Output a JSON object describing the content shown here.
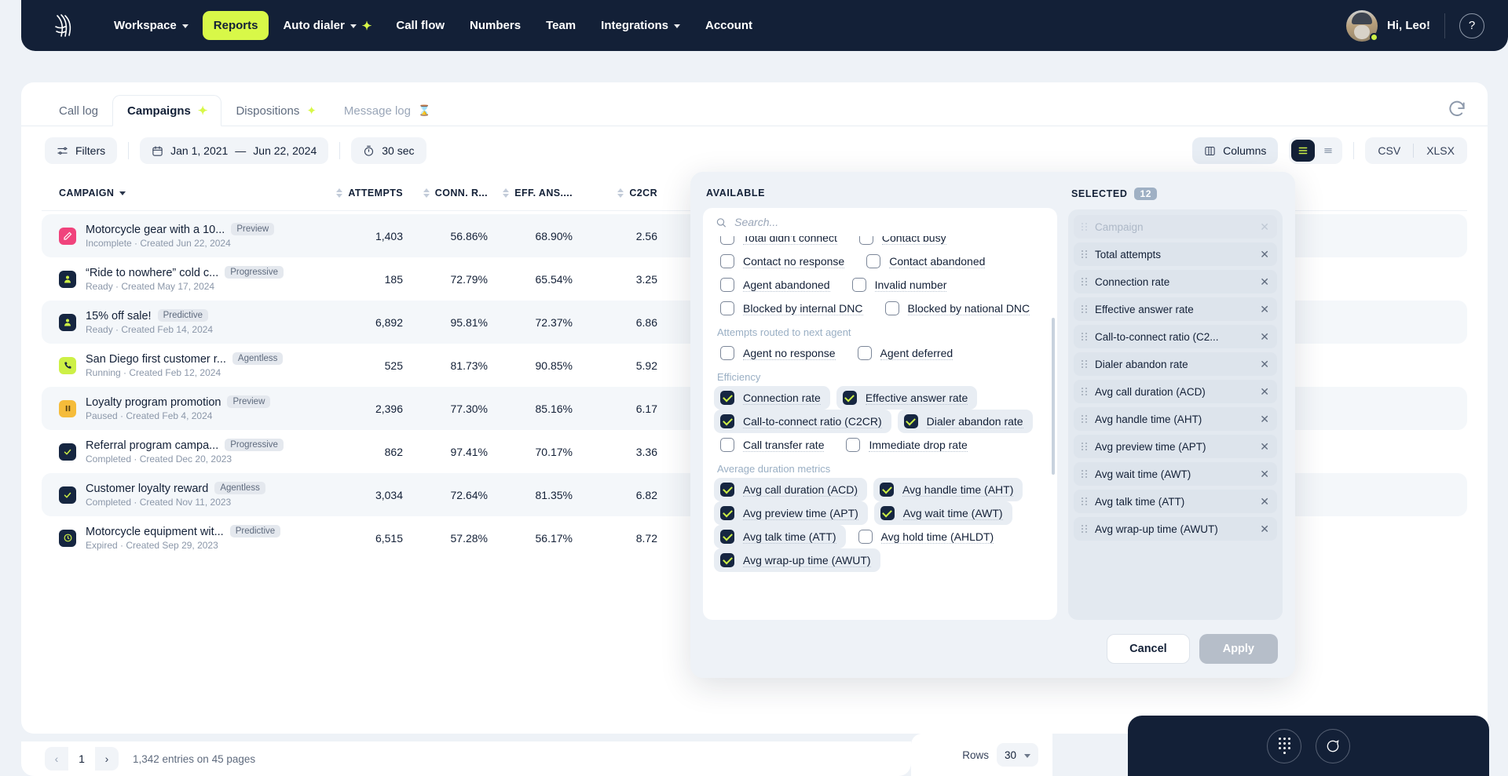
{
  "nav": {
    "logo_icon": "wavy-lines-logo",
    "items": [
      {
        "label": "Workspace",
        "caret": true,
        "sparkle": false,
        "active": false
      },
      {
        "label": "Reports",
        "caret": false,
        "sparkle": false,
        "active": true
      },
      {
        "label": "Auto dialer",
        "caret": true,
        "sparkle": true,
        "active": false
      },
      {
        "label": "Call flow",
        "caret": false,
        "sparkle": false,
        "active": false
      },
      {
        "label": "Numbers",
        "caret": false,
        "sparkle": false,
        "active": false
      },
      {
        "label": "Team",
        "caret": false,
        "sparkle": false,
        "active": false
      },
      {
        "label": "Integrations",
        "caret": true,
        "sparkle": false,
        "active": false
      },
      {
        "label": "Account",
        "caret": false,
        "sparkle": false,
        "active": false
      }
    ],
    "greeting": "Hi, Leo!",
    "help_icon": "question-mark-icon",
    "accent_color": "#d8f848",
    "bar_color": "#132037"
  },
  "tabs": [
    {
      "label": "Call log",
      "active": false,
      "sparkle": false,
      "muted": false,
      "icon": ""
    },
    {
      "label": "Campaigns",
      "active": true,
      "sparkle": true,
      "muted": false,
      "icon": ""
    },
    {
      "label": "Dispositions",
      "active": false,
      "sparkle": true,
      "muted": false,
      "icon": ""
    },
    {
      "label": "Message log",
      "active": false,
      "sparkle": false,
      "muted": true,
      "icon": "hourglass-icon"
    }
  ],
  "toolbar": {
    "filters_label": "Filters",
    "date_start": "Jan 1, 2021",
    "date_dash": "—",
    "date_end": "Jun 22, 2024",
    "interval_label": "30 sec",
    "columns_label": "Columns",
    "export_csv": "CSV",
    "export_xlsx": "XLSX"
  },
  "table": {
    "headers": [
      {
        "label": "CAMPAIGN",
        "sort": "desc-caret"
      },
      {
        "label": "ATTEMPTS",
        "sort": "both"
      },
      {
        "label": "CONN. R...",
        "sort": "both"
      },
      {
        "label": "EFF. ANS....",
        "sort": "both"
      },
      {
        "label": "C2CR",
        "sort": "both"
      }
    ],
    "rows": [
      {
        "icon": "pencil-icon",
        "icon_bg": "#f0437c",
        "name": "Motorcycle gear with a 10...",
        "badge": "Preview",
        "status": "Incomplete",
        "created": "Created Jun 22, 2024",
        "attempts": "1,403",
        "conn": "56.86%",
        "eff": "68.90%",
        "c2cr": "2.56"
      },
      {
        "icon": "person-icon",
        "icon_bg": "#162641",
        "name": "“Ride to nowhere” cold c...",
        "badge": "Progressive",
        "status": "Ready",
        "created": "Created May 17, 2024",
        "attempts": "185",
        "conn": "72.79%",
        "eff": "65.54%",
        "c2cr": "3.25"
      },
      {
        "icon": "person-icon",
        "icon_bg": "#162641",
        "name": "15% off sale!",
        "badge": "Predictive",
        "status": "Ready",
        "created": "Created Feb 14, 2024",
        "attempts": "6,892",
        "conn": "95.81%",
        "eff": "72.37%",
        "c2cr": "6.86"
      },
      {
        "icon": "phone-icon",
        "icon_bg": "#cdf046",
        "name": "San Diego first customer r...",
        "badge": "Agentless",
        "status": "Running",
        "created": "Created Feb 12, 2024",
        "attempts": "525",
        "conn": "81.73%",
        "eff": "90.85%",
        "c2cr": "5.92"
      },
      {
        "icon": "pause-icon",
        "icon_bg": "#f5bc3a",
        "name": "Loyalty program promotion",
        "badge": "Preview",
        "status": "Paused",
        "created": "Created Feb 4, 2024",
        "attempts": "2,396",
        "conn": "77.30%",
        "eff": "85.16%",
        "c2cr": "6.17"
      },
      {
        "icon": "check-icon",
        "icon_bg": "#162641",
        "name": "Referral program campa...",
        "badge": "Progressive",
        "status": "Completed",
        "created": "Created Dec 20, 2023",
        "attempts": "862",
        "conn": "97.41%",
        "eff": "70.17%",
        "c2cr": "3.36"
      },
      {
        "icon": "check-icon",
        "icon_bg": "#162641",
        "name": "Customer loyalty reward",
        "badge": "Agentless",
        "status": "Completed",
        "created": "Created Nov 11, 2023",
        "attempts": "3,034",
        "conn": "72.64%",
        "eff": "81.35%",
        "c2cr": "6.82"
      },
      {
        "icon": "clock-icon",
        "icon_bg": "#162641",
        "name": "Motorcycle equipment wit...",
        "badge": "Predictive",
        "status": "Expired",
        "created": "Created Sep 29, 2023",
        "attempts": "6,515",
        "conn": "57.28%",
        "eff": "56.17%",
        "c2cr": "8.72"
      }
    ]
  },
  "pagination": {
    "prev_icon": "chevron-left-icon",
    "page": "1",
    "next_icon": "chevron-right-icon",
    "entries": "1,342 entries on 45 pages",
    "rows_label": "Rows",
    "rows_value": "30"
  },
  "widget": {
    "dialpad_icon": "dialpad-icon",
    "chat_icon": "chat-bubble-icon"
  },
  "modal": {
    "available_title": "AVAILABLE",
    "selected_title": "SELECTED",
    "selected_count": "12",
    "search_placeholder": "Search...",
    "search_value": "",
    "cancel_label": "Cancel",
    "apply_label": "Apply",
    "available_groups": [
      {
        "group": "",
        "rows": [
          [
            {
              "label": "Total didn’t connect",
              "checked": false
            },
            {
              "label": "Contact busy",
              "checked": false
            }
          ],
          [
            {
              "label": "Contact no response",
              "checked": false
            },
            {
              "label": "Contact abandoned",
              "checked": false
            }
          ],
          [
            {
              "label": "Agent abandoned",
              "checked": false
            },
            {
              "label": "Invalid number",
              "checked": false
            }
          ],
          [
            {
              "label": "Blocked by internal DNC",
              "checked": false
            },
            {
              "label": "Blocked by national DNC",
              "checked": false
            }
          ]
        ]
      },
      {
        "group": "Attempts routed to next agent",
        "rows": [
          [
            {
              "label": "Agent no response",
              "checked": false
            },
            {
              "label": "Agent deferred",
              "checked": false
            }
          ]
        ]
      },
      {
        "group": "Efficiency",
        "rows": [
          [
            {
              "label": "Connection rate",
              "checked": true
            },
            {
              "label": "Effective answer rate",
              "checked": true
            }
          ],
          [
            {
              "label": "Call-to-connect ratio (C2CR)",
              "checked": true
            },
            {
              "label": "Dialer abandon rate",
              "checked": true
            }
          ],
          [
            {
              "label": "Call transfer rate",
              "checked": false
            },
            {
              "label": "Immediate drop rate",
              "checked": false
            }
          ]
        ]
      },
      {
        "group": "Average duration metrics",
        "rows": [
          [
            {
              "label": "Avg call duration (ACD)",
              "checked": true
            },
            {
              "label": "Avg handle time (AHT)",
              "checked": true
            }
          ],
          [
            {
              "label": "Avg preview time (APT)",
              "checked": true
            },
            {
              "label": "Avg wait time (AWT)",
              "checked": true
            }
          ],
          [
            {
              "label": "Avg talk time (ATT)",
              "checked": true
            },
            {
              "label": "Avg hold time (AHLDT)",
              "checked": false
            }
          ],
          [
            {
              "label": "Avg wrap-up time (AWUT)",
              "checked": true
            }
          ]
        ]
      }
    ],
    "selected_items": [
      {
        "label": "Campaign",
        "disabled": true
      },
      {
        "label": "Total attempts",
        "disabled": false
      },
      {
        "label": "Connection rate",
        "disabled": false
      },
      {
        "label": "Effective answer rate",
        "disabled": false
      },
      {
        "label": "Call-to-connect ratio (C2...",
        "disabled": false
      },
      {
        "label": "Dialer abandon rate",
        "disabled": false
      },
      {
        "label": "Avg call duration (ACD)",
        "disabled": false
      },
      {
        "label": "Avg handle time (AHT)",
        "disabled": false
      },
      {
        "label": "Avg preview time (APT)",
        "disabled": false
      },
      {
        "label": "Avg wait time (AWT)",
        "disabled": false
      },
      {
        "label": "Avg talk time (ATT)",
        "disabled": false
      },
      {
        "label": "Avg wrap-up time (AWUT)",
        "disabled": false
      }
    ]
  }
}
